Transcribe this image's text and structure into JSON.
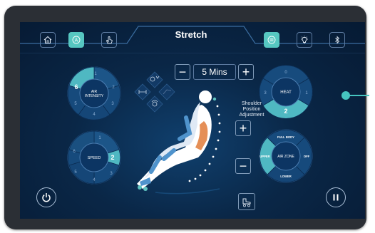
{
  "header": {
    "title": "Stretch",
    "nav_left": [
      {
        "icon": "home-icon"
      },
      {
        "icon": "auto-mode-icon",
        "label": "A",
        "active": true
      },
      {
        "icon": "hand-icon"
      }
    ],
    "nav_right": [
      {
        "icon": "menu-list-icon",
        "active": true
      },
      {
        "icon": "light-icon"
      },
      {
        "icon": "bluetooth-icon"
      }
    ]
  },
  "air_intensity": {
    "label_line1": "AIR",
    "label_line2": "INTENSITY",
    "value": "6",
    "segments": [
      "1",
      "2",
      "3",
      "4",
      "5"
    ]
  },
  "speed": {
    "label": "SPEED",
    "value": "2",
    "segments": [
      "1",
      "3",
      "4",
      "5",
      "6"
    ]
  },
  "heat": {
    "label": "HEAT",
    "value": "2",
    "segments": [
      "0",
      "1",
      "3"
    ]
  },
  "air_zone": {
    "label": "AIR ZONE",
    "top": "FULL BODY",
    "left": "UPPER",
    "right": "OFF",
    "bottom": "LOWER"
  },
  "timer": {
    "minus": "−",
    "value": "5 Mins",
    "plus": "+"
  },
  "shoulder": {
    "label_line1": "Shoulder",
    "label_line2": "Position",
    "label_line3": "Adjustment",
    "up": "+",
    "down": "−"
  },
  "colors": {
    "accent": "#56c7c1",
    "heat_orange": "#e07b3a",
    "screen_bg": "#0a2747"
  }
}
